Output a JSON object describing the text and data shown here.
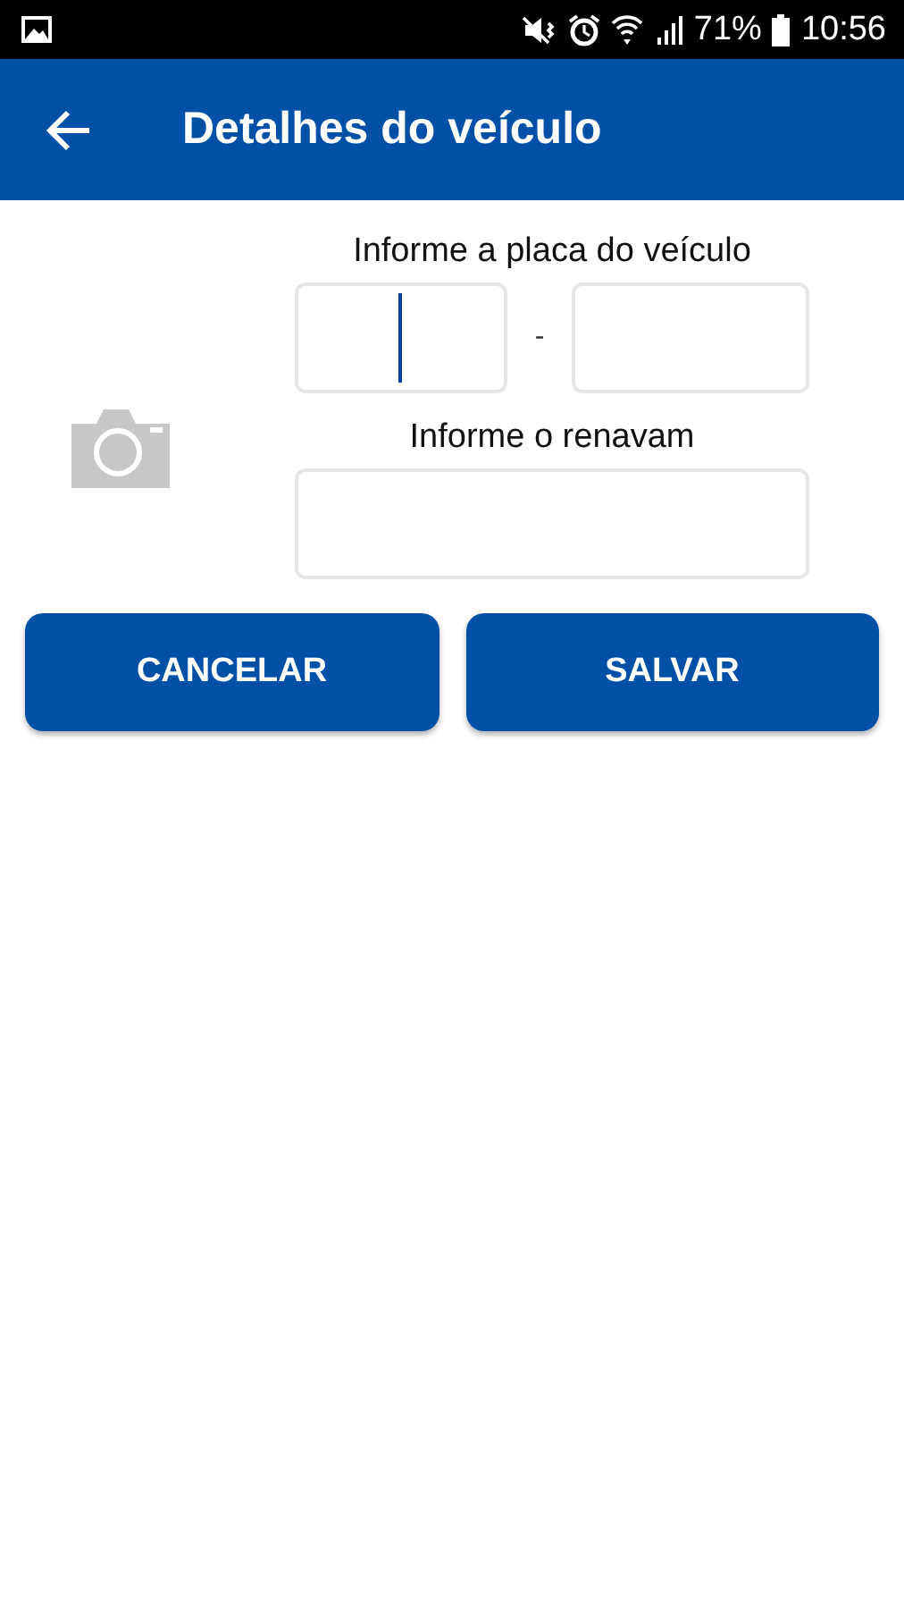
{
  "status_bar": {
    "battery": "71%",
    "time": "10:56"
  },
  "app_bar": {
    "title": "Detalhes do veículo"
  },
  "form": {
    "plate_label": "Informe a placa do veículo",
    "plate_fields": [
      {
        "focused": true
      },
      {
        "focused": false
      }
    ],
    "separator": "-",
    "renavam_label": "Informe o renavam",
    "renavam_field": {
      "focused": false
    }
  },
  "buttons": [
    {
      "label": "CANCELAR"
    },
    {
      "label": "SALVAR"
    }
  ]
}
